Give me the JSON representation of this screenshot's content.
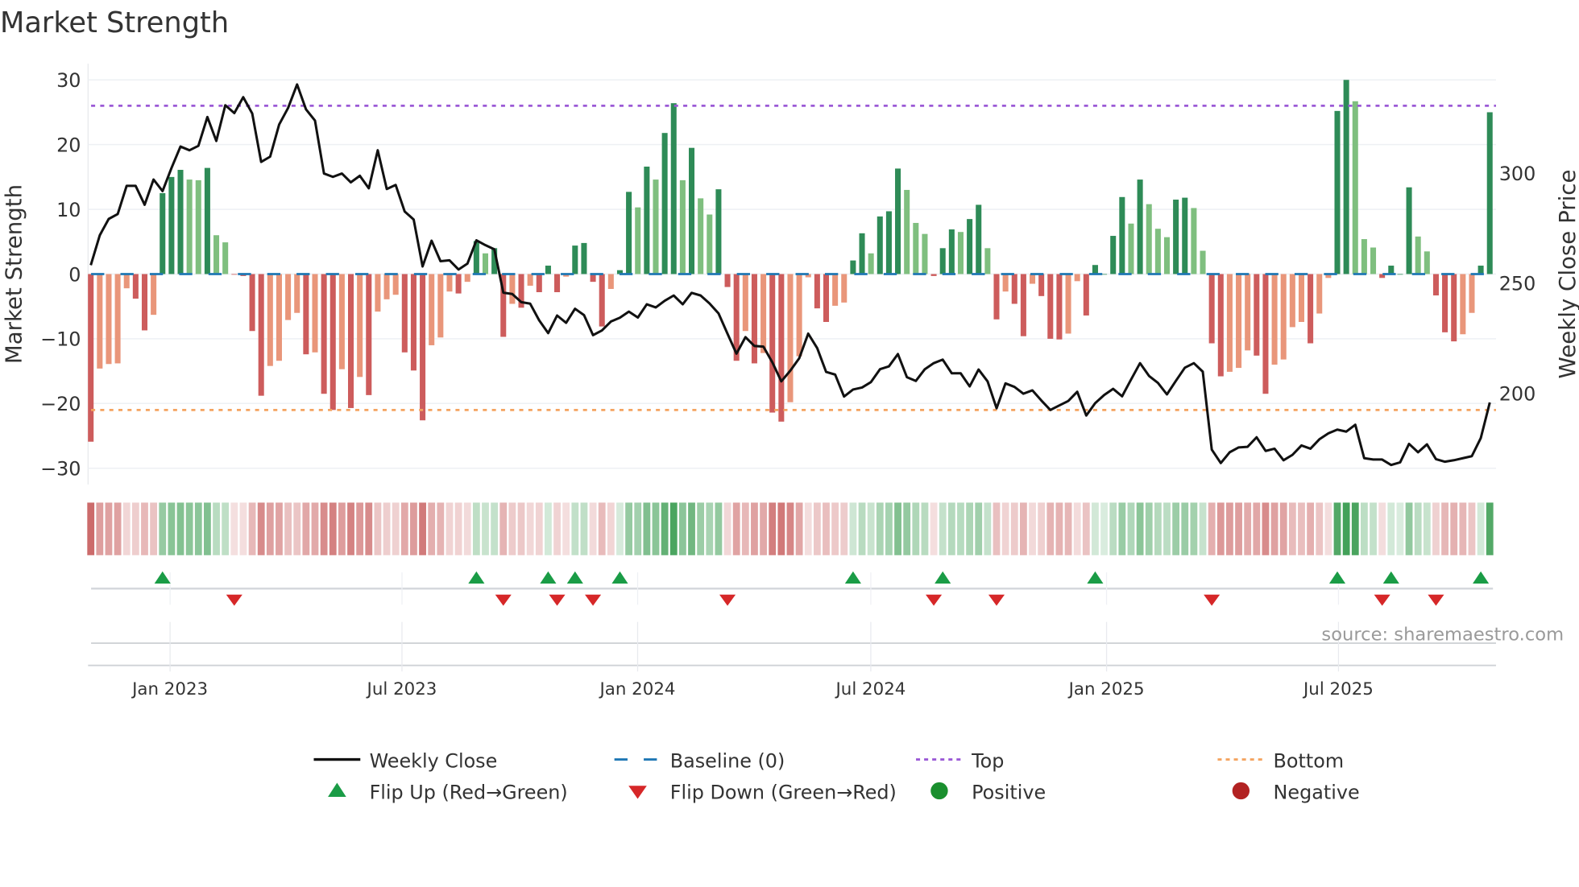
{
  "chart_data": {
    "type": "bar",
    "title": "Market Strength",
    "ylabel": "Market Strength",
    "y2label": "Weekly Close Price",
    "ylim": [
      -32.5,
      32.5
    ],
    "y2lim": [
      158.6,
      349.7
    ],
    "yticks": [
      30,
      20,
      10,
      0,
      -10,
      -20,
      -30
    ],
    "y2ticks": [
      300,
      250,
      200
    ],
    "grid": true,
    "interval": "weekly",
    "xticks": [
      {
        "label": "Jan 2023",
        "week": 8.84
      },
      {
        "label": "Jul 2023",
        "week": 34.7
      },
      {
        "label": "Jan 2024",
        "week": 60.98
      },
      {
        "label": "Jul 2024",
        "week": 86.98
      },
      {
        "label": "Jan 2025",
        "week": 113.27
      },
      {
        "label": "Jul 2025",
        "week": 139.13
      }
    ],
    "top_level": 26,
    "bottom_level": -21,
    "baseline": 0,
    "strength": [
      -25.9,
      -14.6,
      -13.9,
      -13.8,
      -2.2,
      -3.8,
      -8.7,
      -6.3,
      12.5,
      15.0,
      16.1,
      14.6,
      14.5,
      16.4,
      6.0,
      4.9,
      -0.1,
      -0.3,
      -8.8,
      -18.8,
      -14.2,
      -13.4,
      -7.1,
      -6.0,
      -12.4,
      -12.1,
      -18.5,
      -21.0,
      -14.7,
      -20.7,
      -15.9,
      -18.7,
      -5.8,
      -3.9,
      -3.2,
      -12.1,
      -14.9,
      -22.6,
      -11.0,
      -9.8,
      -2.7,
      -3.0,
      -1.2,
      5.1,
      3.2,
      4.0,
      -9.7,
      -4.6,
      -5.2,
      -1.8,
      -2.8,
      1.3,
      -2.8,
      -0.4,
      4.4,
      4.8,
      -1.2,
      -8.1,
      -2.3,
      0.6,
      12.7,
      10.3,
      16.6,
      14.6,
      21.8,
      26.4,
      14.5,
      19.5,
      11.7,
      9.2,
      13.1,
      -2.0,
      -13.4,
      -8.8,
      -13.8,
      -12.2,
      -21.4,
      -22.8,
      -19.8,
      -12.7,
      -0.5,
      -5.3,
      -7.4,
      -4.9,
      -4.4,
      2.1,
      6.3,
      3.2,
      8.9,
      9.7,
      16.3,
      13.0,
      7.9,
      6.2,
      -0.3,
      4.0,
      6.9,
      6.5,
      8.5,
      10.7,
      4.0,
      -7.0,
      -2.7,
      -4.6,
      -9.6,
      -1.5,
      -3.4,
      -10.0,
      -10.1,
      -9.2,
      -1.1,
      -6.4,
      1.4,
      0.0,
      5.9,
      11.9,
      7.8,
      14.6,
      10.8,
      7.0,
      5.7,
      11.5,
      11.8,
      10.2,
      3.6,
      -10.7,
      -15.8,
      -15.1,
      -14.5,
      -11.8,
      -12.6,
      -18.5,
      -14.0,
      -13.2,
      -8.2,
      -7.4,
      -10.7,
      -6.1,
      -0.6,
      25.2,
      30.0,
      26.7,
      5.4,
      4.1,
      -0.6,
      1.3,
      0.0,
      13.4,
      5.8,
      3.5,
      -3.3,
      -9.0,
      -10.4,
      -9.3,
      -6.0,
      1.3,
      25.0
    ],
    "weekly_close": [
      258.2,
      271.8,
      279.2,
      281.4,
      294.2,
      294.2,
      285.6,
      297.1,
      291.8,
      302.3,
      312.1,
      310.4,
      312.4,
      325.5,
      314.6,
      330.8,
      327.3,
      334.5,
      327.1,
      305.1,
      307.5,
      322.1,
      329.6,
      340.3,
      329.0,
      323.9,
      299.8,
      298.3,
      299.8,
      295.8,
      298.8,
      293.1,
      310.4,
      292.8,
      294.6,
      282.6,
      278.9,
      257.6,
      269.3,
      260.0,
      260.4,
      256.2,
      258.9,
      269.5,
      267.3,
      265.4,
      245.7,
      245.1,
      241.4,
      240.7,
      233.1,
      227.3,
      235.3,
      232.0,
      238.4,
      235.5,
      226.4,
      228.5,
      232.6,
      234.3,
      237.1,
      234.4,
      240.4,
      239.0,
      242.0,
      244.4,
      240.4,
      245.6,
      244.4,
      240.8,
      236.3,
      227.0,
      218.0,
      225.5,
      221.5,
      221.2,
      214.0,
      205.4,
      210.3,
      215.9,
      227.1,
      220.5,
      209.7,
      208.5,
      198.5,
      201.7,
      202.6,
      205.1,
      210.9,
      212.2,
      217.8,
      207.3,
      205.6,
      210.9,
      213.7,
      215.3,
      209.1,
      209.1,
      203.1,
      210.8,
      205.4,
      193.2,
      204.5,
      202.9,
      199.8,
      201.3,
      196.7,
      192.4,
      194.5,
      196.5,
      200.7,
      189.9,
      195.5,
      199.2,
      202.0,
      198.6,
      206.3,
      213.7,
      207.9,
      204.7,
      199.5,
      205.7,
      211.6,
      213.7,
      209.8,
      174.4,
      168.3,
      173.2,
      175.4,
      175.7,
      180.0,
      173.8,
      174.8,
      169.6,
      172.0,
      176.3,
      174.8,
      179.1,
      181.8,
      183.5,
      182.6,
      185.7,
      170.5,
      169.9,
      169.9,
      167.4,
      168.6,
      177.0,
      173.2,
      176.8,
      170.1,
      168.9,
      169.6,
      170.5,
      171.4,
      179.7,
      195.8
    ],
    "flip_up_weeks": [
      8,
      43,
      51,
      54,
      59,
      85,
      95,
      112,
      139,
      145,
      155
    ],
    "flip_down_weeks": [
      16,
      46,
      52,
      56,
      71,
      94,
      101,
      125,
      144,
      150
    ],
    "legend": {
      "placement": "bottom",
      "entries": [
        "Weekly Close",
        "Baseline (0)",
        "Top",
        "Bottom",
        "Flip Up (Red→Green)",
        "Flip Down (Green→Red)",
        "Positive",
        "Negative"
      ]
    },
    "annotation": "source: sharemaestro.com",
    "colors": {
      "pos_strong": "#2e8b57",
      "pos_weak": "#7fbf7f",
      "neg_strong": "#cd5c5c",
      "neg_weak": "#e9967a",
      "line": "#111111",
      "baseline": "#1f77b4",
      "top": "#9b59d6",
      "bottom": "#f4a460",
      "flip_up": "#1a9c46",
      "flip_down": "#d62728",
      "positive": "#1a8f2e",
      "negative": "#b22222"
    }
  }
}
